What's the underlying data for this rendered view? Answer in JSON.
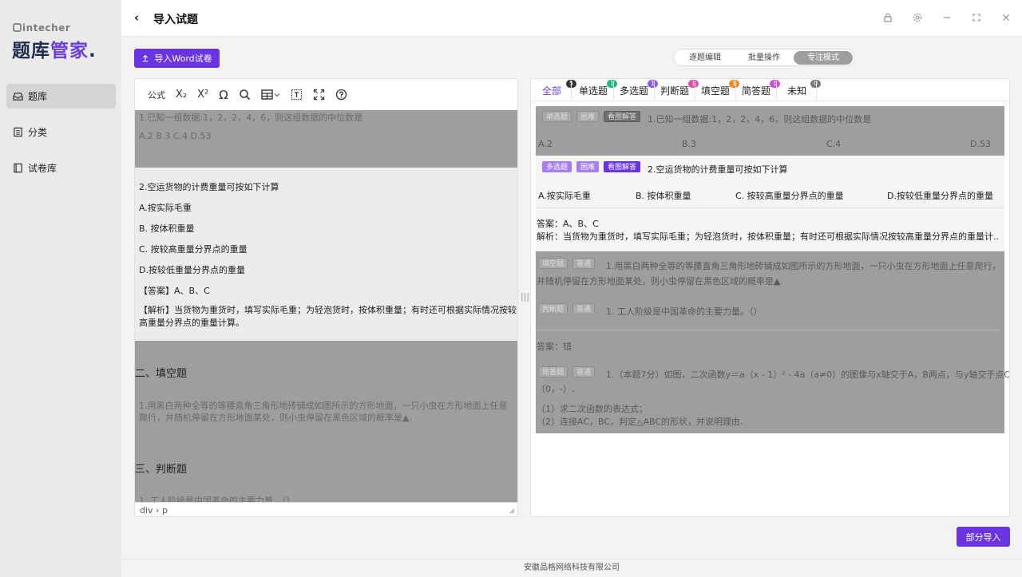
{
  "sidebar": {
    "brand": "intecher",
    "logo_main": "题库",
    "logo_accent": "管家",
    "logo_dot": ".",
    "items": [
      {
        "label": "题库",
        "icon": "bank-icon"
      },
      {
        "label": "分类",
        "icon": "list-icon"
      },
      {
        "label": "试卷库",
        "icon": "book-icon"
      }
    ]
  },
  "header": {
    "back": "‹",
    "title": "导入试题"
  },
  "toolbar": {
    "import_word": "导入Word试卷",
    "modes": [
      "逐题编辑",
      "批量操作",
      "专注模式"
    ],
    "active_mode": "专注模式"
  },
  "editor": {
    "tools": {
      "formula": "公式",
      "sub": "X₂",
      "sup": "X²",
      "omega": "Ω"
    },
    "q1_text": "1.已知一组数据:1，2，2，4，6，则这组数据的中位数是",
    "q1_options": "A.2 B.3 C.4 D.53",
    "q2_text": "2.空运货物的计费重量可按如下计算",
    "q2_a": "A.按实际毛重",
    "q2_b": "B. 按体积重量",
    "q2_c": "C. 按较高重量分界点的重量",
    "q2_d": "D.按较低重量分界点的重量",
    "q2_answer": "【答案】A、B、C",
    "q2_analysis": "【解析】当货物为重货时，填写实际毛重；为轻泡货时，按体积重量；有时还可根据实际情况按较高重量分界点的重量计算。",
    "section2": "二、填空题",
    "fill_q1": "1.用黑白两种全等的等腰直角三角形地砖铺成如图所示的方形地面，一只小虫在方形地面上任意爬行，并随机停留在方形地面某处，则小虫停留在黑色区域的概率是▲.",
    "section3": "三、判断题",
    "judge_q1": "1. 工人阶级是中国革命的主要力量。（）",
    "status": "div › p"
  },
  "tabs": [
    {
      "label": "全部",
      "count": "5",
      "color": "#333333"
    },
    {
      "label": "单选题",
      "count": "1",
      "color": "#1fb886"
    },
    {
      "label": "多选题",
      "count": "1",
      "color": "#8b5cf6"
    },
    {
      "label": "判断题",
      "count": "1",
      "color": "#e54ba8"
    },
    {
      "label": "填空题",
      "count": "1",
      "color": "#f08a24"
    },
    {
      "label": "简答题",
      "count": "1",
      "color": "#d44be0"
    },
    {
      "label": "未知",
      "count": "0",
      "color": "#777777"
    }
  ],
  "questions": {
    "q1": {
      "type": "单选题",
      "level": "困难",
      "view": "看图解答",
      "text": "1.已知一组数据:1，2，2，4，6，则这组数据的中位数是",
      "options": [
        "A.2",
        "B.3",
        "C.4",
        "D.53"
      ]
    },
    "q2": {
      "type": "多选题",
      "level": "困难",
      "view": "看图解答",
      "text": "2.空运货物的计费重量可按如下计算",
      "options": [
        "A.按实际毛重",
        "B. 按体积重量",
        "C. 按较高重量分界点的重量",
        "D.按较低重量分界点的重量"
      ],
      "answer": "答案：A、B、C",
      "analysis": "解析：当货物为重货时，填写实际毛重；为轻泡货时，按体积重量；有时还可根据实际情况按较高重量分界点的重量计..."
    },
    "q3": {
      "type": "填空题",
      "level": "普通",
      "text1": "1.用黑白两种全等的等腰直角三角形地砖铺成如图所示的方形地面，一只小虫在方形地面上任意爬行，",
      "text2": "并随机停留在方形地面某处，则小虫停留在黑色区域的概率是▲."
    },
    "q4": {
      "type": "判断题",
      "level": "普通",
      "text": "1. 工人阶级是中国革命的主要力量。（）",
      "answer": "答案：错"
    },
    "q5": {
      "type": "简答题",
      "level": "普通",
      "text1": "1.（本题7分）如图，二次函数y＝a（x - 1）² - 4a（a≠0）的图像与x轴交于A，B两点，与y轴交于点C",
      "text2": "（0，-）.",
      "sub1": "（1）求二次函数的表达式；",
      "sub2": "（2）连接AC，BC，判定△ABC的形状，并说明理由."
    }
  },
  "actions": {
    "partial_import": "部分导入"
  },
  "footer": "安徽品格网络科技有限公司"
}
